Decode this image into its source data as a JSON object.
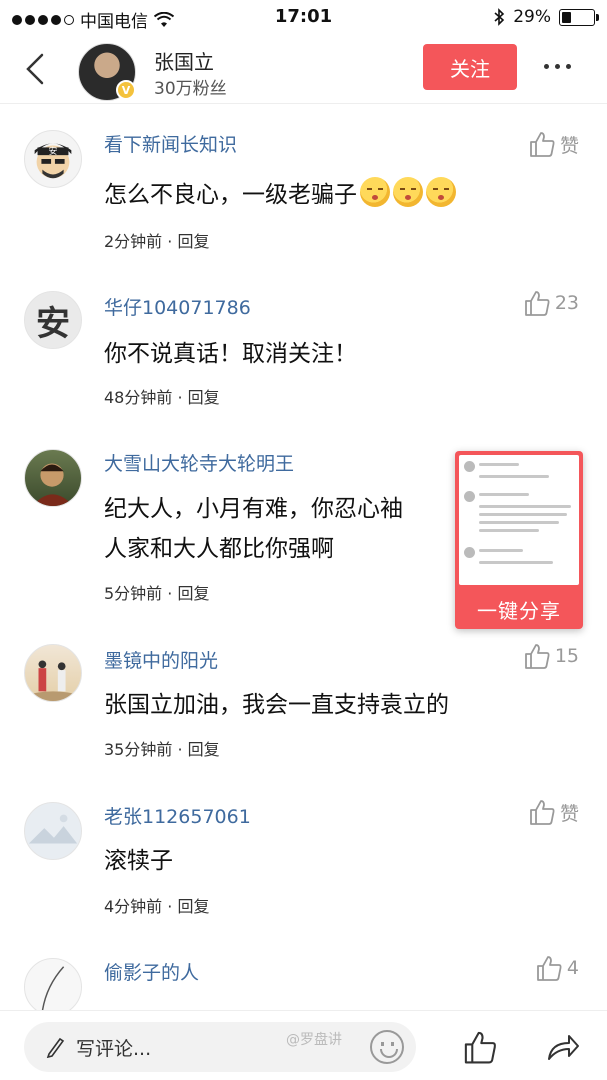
{
  "status_bar": {
    "carrier": "中国电信",
    "time": "17:01",
    "battery": "29%"
  },
  "header": {
    "name": "张国立",
    "fans": "30万粉丝",
    "follow_label": "关注"
  },
  "comments": [
    {
      "name": "看下新闻长知识",
      "text": "怎么不良心，一级老骗子",
      "emoji_count": 3,
      "time": "2分钟前",
      "reply": "回复",
      "likes": "赞"
    },
    {
      "name": "华仔104071786",
      "text": "你不说真话！取消关注！",
      "time": "48分钟前",
      "reply": "回复",
      "likes": "23"
    },
    {
      "name": "大雪山大轮寺大轮明王",
      "text": "纪大人，小月有难，你忍心袖",
      "text2": "人家和大人都比你强啊",
      "time": "5分钟前",
      "reply": "回复",
      "likes": ""
    },
    {
      "name": "墨镜中的阳光",
      "text": "张国立加油，我会一直支持袁立的",
      "time": "35分钟前",
      "reply": "回复",
      "likes": "15"
    },
    {
      "name": "老张112657061",
      "text": "滚犊子",
      "time": "4分钟前",
      "reply": "回复",
      "likes": "赞"
    },
    {
      "name": "偷影子的人",
      "text": "",
      "time": "",
      "reply": "",
      "likes": "4"
    }
  ],
  "share_popup": {
    "label": "一键分享"
  },
  "bottom_bar": {
    "comment_placeholder": "写评论...",
    "watermark": "@罗盘讲"
  },
  "colors": {
    "accent": "#f4565a",
    "username": "#3f6a9e"
  },
  "icons": [
    "back-arrow-icon",
    "verified-badge-icon",
    "more-dots-icon",
    "thumbs-up-icon",
    "pencil-icon",
    "emoji-icon",
    "share-arrow-icon",
    "wifi-icon",
    "bluetooth-icon",
    "battery-icon"
  ]
}
